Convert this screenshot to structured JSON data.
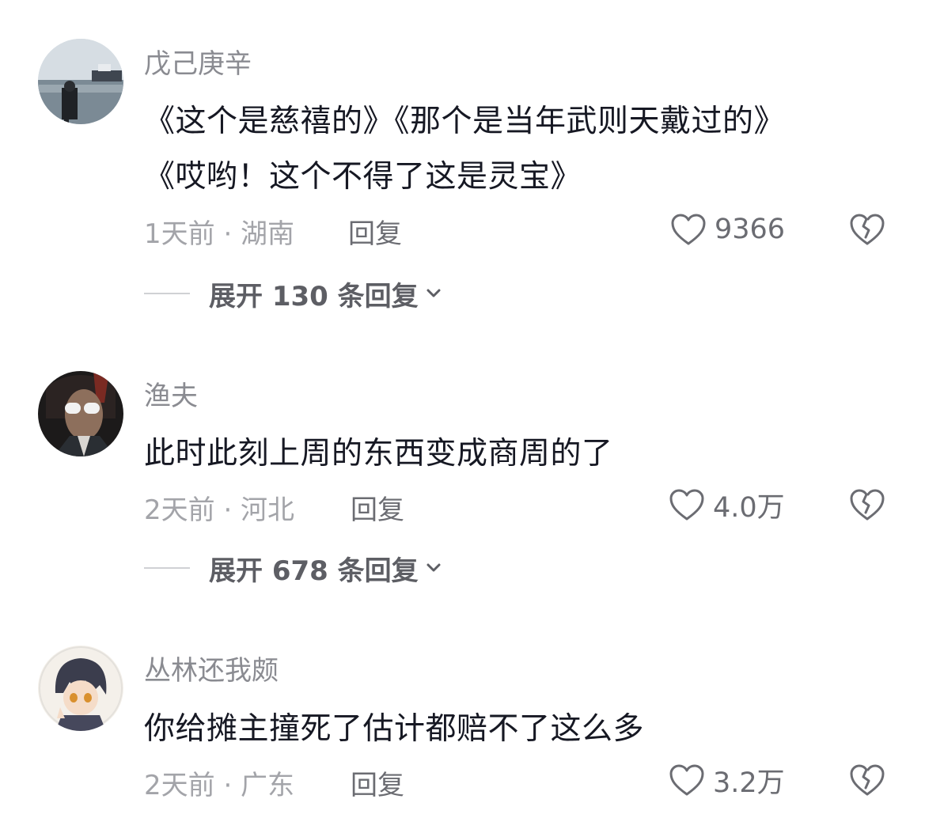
{
  "comments": [
    {
      "username": "戊己庚辛",
      "lines": [
        "《这个是慈禧的》《那个是当年武则天戴过的》",
        "《哎哟！这个不得了这是灵宝》"
      ],
      "meta": "1天前 · 湖南",
      "reply_label": "回复",
      "likes": "9366",
      "expand_label": "展开 130 条回复"
    },
    {
      "username": "渔夫",
      "lines": [
        "此时此刻上周的东西变成商周的了"
      ],
      "meta": "2天前 · 河北",
      "reply_label": "回复",
      "likes": "4.0万",
      "expand_label": "展开 678 条回复"
    },
    {
      "username": "丛林还我颇",
      "lines": [
        "你给摊主撞死了估计都赔不了这么多"
      ],
      "meta": "2天前 · 广东",
      "reply_label": "回复",
      "likes": "3.2万"
    }
  ],
  "icons": {
    "like": "heart-outline-icon",
    "dislike": "broken-heart-icon",
    "expand": "chevron-down-icon"
  },
  "colors": {
    "username": "#8a8b91",
    "text": "#161823",
    "meta": "#a3a4a9",
    "action": "#6b6c72"
  }
}
